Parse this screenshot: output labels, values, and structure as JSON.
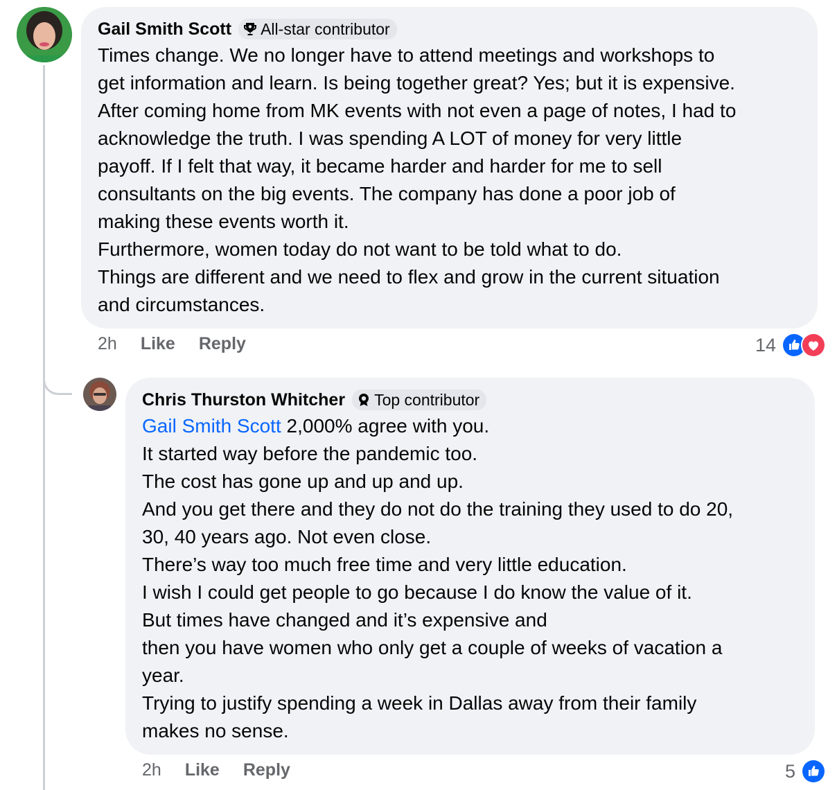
{
  "colors": {
    "bubble_bg": "#f0f2f5",
    "badge_bg": "#e4e6eb",
    "mention": "#0866ff",
    "secondary_text": "#65676b",
    "like_blue": "#0866ff",
    "love_red": "#f33e58"
  },
  "comments": [
    {
      "author": "Gail Smith Scott",
      "badge": {
        "icon": "trophy-icon",
        "label": "All-star contributor"
      },
      "lines": [
        "Times change. We no longer have to attend meetings and workshops to",
        "get information and learn. Is being together great? Yes; but it is expensive.",
        "After coming home from MK events with not even a page of notes, I had to",
        "acknowledge the truth. I was spending A LOT of money for very little",
        "payoff. If I felt that way, it became harder and harder for me to sell",
        "consultants on the big events. The company has done a poor job of",
        "making these events worth it.",
        "Furthermore, women today do not want to be told what to do.",
        "Things are different and we need to flex and grow in the current situation",
        "and circumstances."
      ],
      "time": "2h",
      "like_label": "Like",
      "reply_label": "Reply",
      "reaction_count": "14",
      "reaction_icons": [
        "like-icon",
        "love-icon"
      ]
    },
    {
      "author": "Chris Thurston Whitcher",
      "badge": {
        "icon": "award-icon",
        "label": "Top contributor"
      },
      "mention": "Gail Smith Scott",
      "first_line_rest": " 2,000% agree with you.",
      "lines": [
        "It started way before the pandemic too.",
        "The cost has gone up and up and up.",
        "And you get there and they do not do the training they used to do 20,",
        "30, 40 years ago. Not even close.",
        "There’s way too much free time and very little education.",
        "I wish I could get people to go because I do know the value of it.",
        "But times have changed and it’s expensive and",
        "then you have women who only get a couple of weeks of vacation a",
        "year.",
        "Trying to justify spending a week in Dallas away from their family",
        "makes no sense."
      ],
      "time": "2h",
      "like_label": "Like",
      "reply_label": "Reply",
      "reaction_count": "5",
      "reaction_icons": [
        "like-icon"
      ]
    }
  ]
}
